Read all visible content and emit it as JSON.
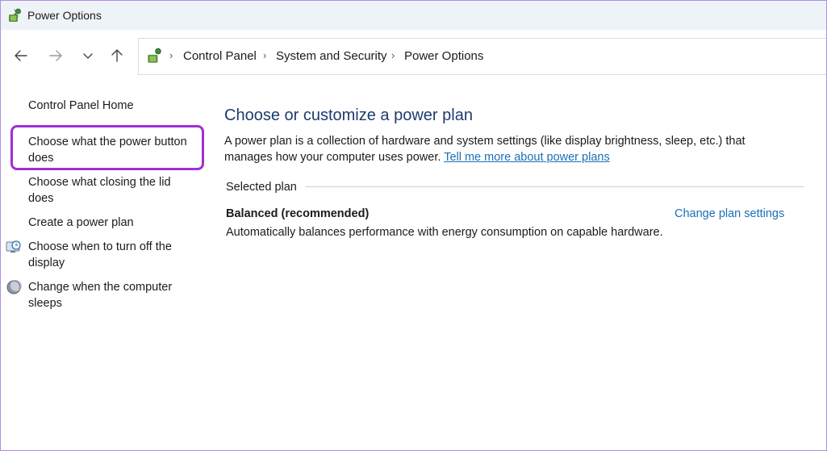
{
  "window": {
    "title": "Power Options",
    "icon": "power-options-icon"
  },
  "nav": {
    "back_icon": "arrow-left-icon",
    "forward_icon": "arrow-right-icon",
    "recent_icon": "chevron-down-icon",
    "up_icon": "arrow-up-icon"
  },
  "breadcrumb": {
    "items": [
      "Control Panel",
      "System and Security",
      "Power Options"
    ],
    "separator": "›"
  },
  "sidebar": {
    "items": [
      {
        "label": "Control Panel Home"
      },
      {
        "label_line1": "Choose what the power button",
        "label_line2": "does",
        "highlighted": true
      },
      {
        "label_line1": "Choose what closing the lid",
        "label_line2": "does"
      },
      {
        "label": "Create a power plan"
      },
      {
        "label_line1": "Choose when to turn off the",
        "label_line2": "display",
        "icon": "monitor-clock-icon"
      },
      {
        "label_line1": "Change when the computer",
        "label_line2": "sleeps",
        "icon": "moon-icon"
      }
    ],
    "highlight_color": "#a12fd4"
  },
  "main": {
    "heading": "Choose or customize a power plan",
    "description": "A power plan is a collection of hardware and system settings (like display brightness, sleep, etc.) that manages how your computer uses power.",
    "description_link": "Tell me more about power plans",
    "section_label": "Selected plan",
    "plan": {
      "name": "Balanced (recommended)",
      "description": "Automatically balances performance with energy consumption on capable hardware.",
      "change_link": "Change plan settings"
    }
  },
  "colors": {
    "heading": "#1e3b6e",
    "link": "#1a6fb5",
    "window_border": "#b18be8",
    "titlebar_bg": "#eef3f8"
  }
}
